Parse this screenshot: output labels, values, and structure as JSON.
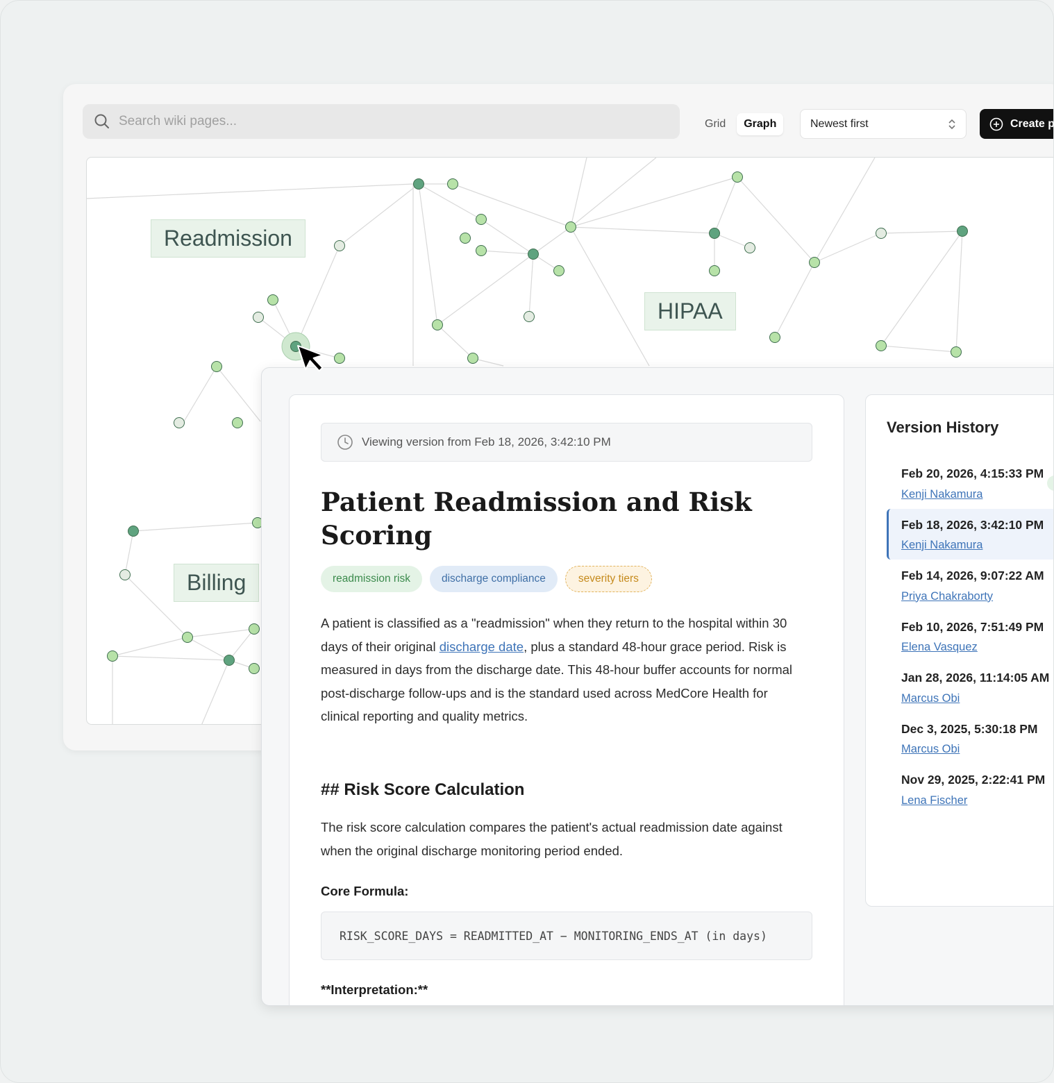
{
  "search": {
    "placeholder": "Search wiki pages..."
  },
  "view_toggle": {
    "grid_label": "Grid",
    "graph_label": "Graph",
    "active": "Graph"
  },
  "sort": {
    "selected": "Newest first"
  },
  "create_button": {
    "label": "Create p"
  },
  "graph": {
    "clusters": [
      {
        "label": "Readmission"
      },
      {
        "label": "HIPAA"
      },
      {
        "label": "Billing"
      }
    ],
    "colors": {
      "node_light": "#b7e2a8",
      "node_dark": "#5fa37f",
      "node_gray": "#e4ece2",
      "edge": "#d9d9d9"
    }
  },
  "article": {
    "version_banner": "Viewing version from Feb 18, 2026, 3:42:10 PM",
    "title": "Patient Readmission and Risk Scoring",
    "tags": [
      {
        "label": "readmission risk",
        "color": "#3b8a4c"
      },
      {
        "label": "discharge compliance",
        "color": "#3f6fa6"
      },
      {
        "label": "severity tiers",
        "color": "#c58a1c"
      }
    ],
    "intro_before_link": "A patient is classified as a \"readmission\" when they return to the hospital within 30 days of their original ",
    "intro_link": "discharge date",
    "intro_after_link": ", plus a standard 48-hour grace period. Risk is measured in days from the discharge date. This 48-hour buffer accounts for normal post-discharge follow-ups and is the standard used across MedCore Health for clinical reporting and quality metrics.",
    "section_heading": "## Risk Score Calculation",
    "section_para": "The risk score calculation compares the patient's actual readmission date against when the original discharge monitoring period ended.",
    "formula_heading": "Core Formula:",
    "formula": "RISK_SCORE_DAYS = READMITTED_AT − MONITORING_ENDS_AT (in days)",
    "interpretation_heading": "**Interpretation:**"
  },
  "history": {
    "title": "Version History",
    "items": [
      {
        "date": "Feb 20, 2026, 4:15:33 PM",
        "author": "Kenji Nakamura",
        "current": true
      },
      {
        "date": "Feb 18, 2026, 3:42:10 PM",
        "author": "Kenji Nakamura",
        "selected": true
      },
      {
        "date": "Feb 14, 2026, 9:07:22 AM",
        "author": "Priya Chakraborty"
      },
      {
        "date": "Feb 10, 2026, 7:51:49 PM",
        "author": "Elena Vasquez"
      },
      {
        "date": "Jan 28, 2026, 11:14:05 AM",
        "author": "Marcus Obi"
      },
      {
        "date": "Dec 3, 2025, 5:30:18 PM",
        "author": "Marcus Obi"
      },
      {
        "date": "Nov 29, 2025, 2:22:41 PM",
        "author": "Lena Fischer"
      }
    ]
  }
}
